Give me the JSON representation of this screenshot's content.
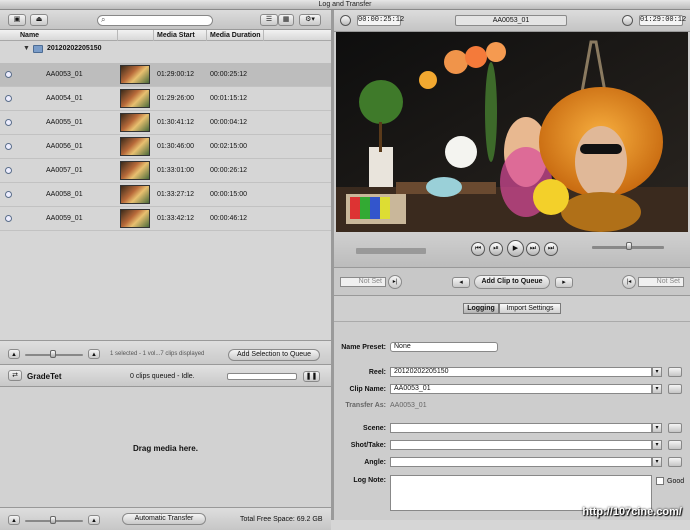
{
  "window": {
    "title": "Log and Transfer"
  },
  "browser": {
    "columns": {
      "name": "Name",
      "media_start": "Media Start",
      "media_duration": "Media Duration"
    },
    "folder": "20120202205150",
    "clips": [
      {
        "name": "AA0053_01",
        "start": "01:29:00:12",
        "duration": "00:00:25:12",
        "selected": true
      },
      {
        "name": "AA0054_01",
        "start": "01:29:26:00",
        "duration": "00:01:15:12",
        "selected": false
      },
      {
        "name": "AA0055_01",
        "start": "01:30:41:12",
        "duration": "00:00:04:12",
        "selected": false
      },
      {
        "name": "AA0056_01",
        "start": "01:30:46:00",
        "duration": "00:02:15:00",
        "selected": false
      },
      {
        "name": "AA0057_01",
        "start": "01:33:01:00",
        "duration": "00:00:26:12",
        "selected": false
      },
      {
        "name": "AA0058_01",
        "start": "01:33:27:12",
        "duration": "00:00:15:00",
        "selected": false
      },
      {
        "name": "AA0059_01",
        "start": "01:33:42:12",
        "duration": "00:00:46:12",
        "selected": false
      }
    ],
    "status_text": "1 selected - 1 vol...7 clips displayed",
    "add_selection_label": "Add Selection to Queue"
  },
  "queue": {
    "volume_name": "GradeTet",
    "status": "0 clips queued - Idle.",
    "drop_hint": "Drag media here.",
    "auto_transfer_label": "Automatic Transfer",
    "free_space": "Total Free Space: 69.2 GB"
  },
  "viewer": {
    "in_timecode": "00:00:25:12",
    "clip_name": "AA0053_01",
    "out_timecode": "01:29:00:12",
    "mark_in": "Not Set",
    "mark_out": "Not Set",
    "add_clip_label": "Add Clip to Queue"
  },
  "tabs": {
    "logging": "Logging",
    "import_settings": "Import Settings"
  },
  "logging": {
    "name_preset_label": "Name Preset:",
    "name_preset_value": "None",
    "reel_label": "Reel:",
    "reel_value": "20120202205150",
    "clip_name_label": "Clip Name:",
    "clip_name_value": "AA0053_01",
    "transfer_as_label": "Transfer As:",
    "transfer_as_value": "AA0053_01",
    "scene_label": "Scene:",
    "shot_label": "Shot/Take:",
    "angle_label": "Angle:",
    "log_note_label": "Log Note:",
    "good_label": "Good"
  },
  "watermark": "http://107cine.com/",
  "colors": {
    "accent": "#5a7fb5",
    "video_bg": "#111111"
  }
}
